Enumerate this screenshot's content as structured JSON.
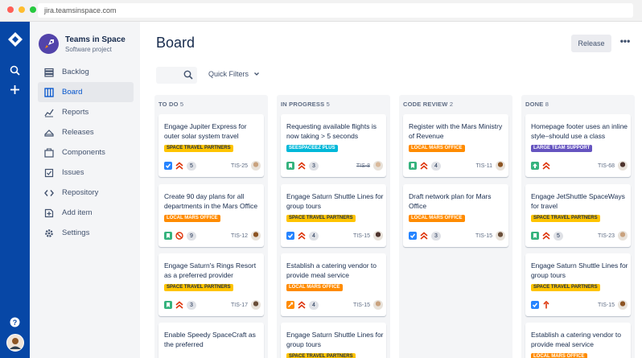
{
  "browser": {
    "url": "jira.teamsinspace.com",
    "dot_colors": [
      "#FF5F56",
      "#FFBD2E",
      "#27C93F"
    ]
  },
  "global_nav": {
    "icons": [
      "jira-logo-icon",
      "search-icon",
      "create-icon",
      "help-icon",
      "user-avatar"
    ]
  },
  "project": {
    "name": "Teams in Space",
    "type": "Software project"
  },
  "sidebar": {
    "items": [
      {
        "label": "Backlog",
        "icon": "backlog-icon"
      },
      {
        "label": "Board",
        "icon": "board-icon",
        "active": true
      },
      {
        "label": "Reports",
        "icon": "reports-icon"
      },
      {
        "label": "Releases",
        "icon": "releases-icon"
      },
      {
        "label": "Components",
        "icon": "components-icon"
      },
      {
        "label": "Issues",
        "icon": "issues-icon"
      },
      {
        "label": "Repository",
        "icon": "repository-icon"
      },
      {
        "label": "Add item",
        "icon": "add-item-icon"
      },
      {
        "label": "Settings",
        "icon": "settings-icon"
      }
    ]
  },
  "header": {
    "title": "Board",
    "release_label": "Release",
    "more_label": "•••"
  },
  "filters": {
    "search_placeholder": "",
    "quick_filters_label": "Quick Filters"
  },
  "colors": {
    "story": "#36B37E",
    "task": "#2684FF",
    "improvement": "#FF8B00",
    "blocker": "#DE350B",
    "nav": "#0747A6"
  },
  "columns": [
    {
      "title": "TO DO",
      "count": "5",
      "cards": [
        {
          "title": "Engage Jupiter Express for outer solar system travel",
          "label": "SPACE TRAVEL PARTNERS",
          "label_color": "#FFC400",
          "label_text": "#172B4D",
          "type": "task",
          "priority": "highest",
          "estimate": "5",
          "key": "TIS-25",
          "done": false
        },
        {
          "title": "Create 90 day plans for all departments in the Mars Office",
          "label": "LOCAL MARS OFFICE",
          "label_color": "#FF8B00",
          "label_text": "#fff",
          "type": "story",
          "priority": "blocker",
          "estimate": "9",
          "key": "TIS-12",
          "done": false
        },
        {
          "title": "Engage Saturn's Rings Resort as a preferred provider",
          "label": "SPACE TRAVEL PARTNERS",
          "label_color": "#FFC400",
          "label_text": "#172B4D",
          "type": "story",
          "priority": "highest",
          "estimate": "3",
          "key": "TIS-17",
          "done": false
        },
        {
          "title": "Enable Speedy SpaceCraft as the preferred",
          "label": "",
          "type": "",
          "priority": "",
          "estimate": "",
          "key": "",
          "done": false
        }
      ]
    },
    {
      "title": "IN PROGRESS",
      "count": "5",
      "cards": [
        {
          "title": "Requesting available flights is now taking > 5 seconds",
          "label": "SEESPACEEZ PLUS",
          "label_color": "#00B8D9",
          "label_text": "#fff",
          "type": "story",
          "priority": "highest",
          "estimate": "3",
          "key": "TIS-8",
          "done": true
        },
        {
          "title": "Engage Saturn Shuttle Lines for group tours",
          "label": "SPACE TRAVEL PARTNERS",
          "label_color": "#FFC400",
          "label_text": "#172B4D",
          "type": "task",
          "priority": "highest",
          "estimate": "4",
          "key": "TIS-15",
          "done": false
        },
        {
          "title": "Establish a catering vendor to provide meal service",
          "label": "LOCAL MARS OFFICE",
          "label_color": "#FF8B00",
          "label_text": "#fff",
          "type": "improvement",
          "priority": "highest",
          "estimate": "4",
          "key": "TIS-15",
          "done": false
        },
        {
          "title": "Engage Saturn Shuttle Lines for group tours",
          "label": "SPACE TRAVEL PARTNERS",
          "label_color": "#FFC400",
          "label_text": "#172B4D",
          "type": "",
          "priority": "",
          "estimate": "",
          "key": "",
          "done": false
        }
      ]
    },
    {
      "title": "CODE REVIEW",
      "count": "2",
      "cards": [
        {
          "title": "Register with the Mars Ministry of Revenue",
          "label": "LOCAL MARS OFFICE",
          "label_color": "#FF8B00",
          "label_text": "#fff",
          "type": "story",
          "priority": "highest",
          "estimate": "4",
          "key": "TIS-11",
          "done": false
        },
        {
          "title": "Draft network plan for Mars Office",
          "label": "LOCAL MARS OFFICE",
          "label_color": "#FF8B00",
          "label_text": "#fff",
          "type": "task",
          "priority": "highest",
          "estimate": "3",
          "key": "TIS-15",
          "done": false
        }
      ]
    },
    {
      "title": "DONE",
      "count": "8",
      "cards": [
        {
          "title": "Homepage footer uses an inline style–should use a class",
          "label": "LARGE TEAM SUPPORT",
          "label_color": "#6554C0",
          "label_text": "#fff",
          "type": "story-up",
          "priority": "highest",
          "estimate": "",
          "key": "TIS-68",
          "done": false
        },
        {
          "title": "Engage JetShuttle SpaceWays for travel",
          "label": "SPACE TRAVEL PARTNERS",
          "label_color": "#FFC400",
          "label_text": "#172B4D",
          "type": "story",
          "priority": "highest",
          "estimate": "5",
          "key": "TIS-23",
          "done": false
        },
        {
          "title": "Engage Saturn Shuttle Lines for group tours",
          "label": "SPACE TRAVEL PARTNERS",
          "label_color": "#FFC400",
          "label_text": "#172B4D",
          "type": "task",
          "priority": "critical",
          "estimate": "",
          "key": "TIS-15",
          "done": false
        },
        {
          "title": "Establish a catering vendor to provide meal service",
          "label": "LOCAL MARS OFFICE",
          "label_color": "#FF8B00",
          "label_text": "#fff",
          "type": "",
          "priority": "",
          "estimate": "",
          "key": "",
          "done": false
        }
      ]
    }
  ]
}
